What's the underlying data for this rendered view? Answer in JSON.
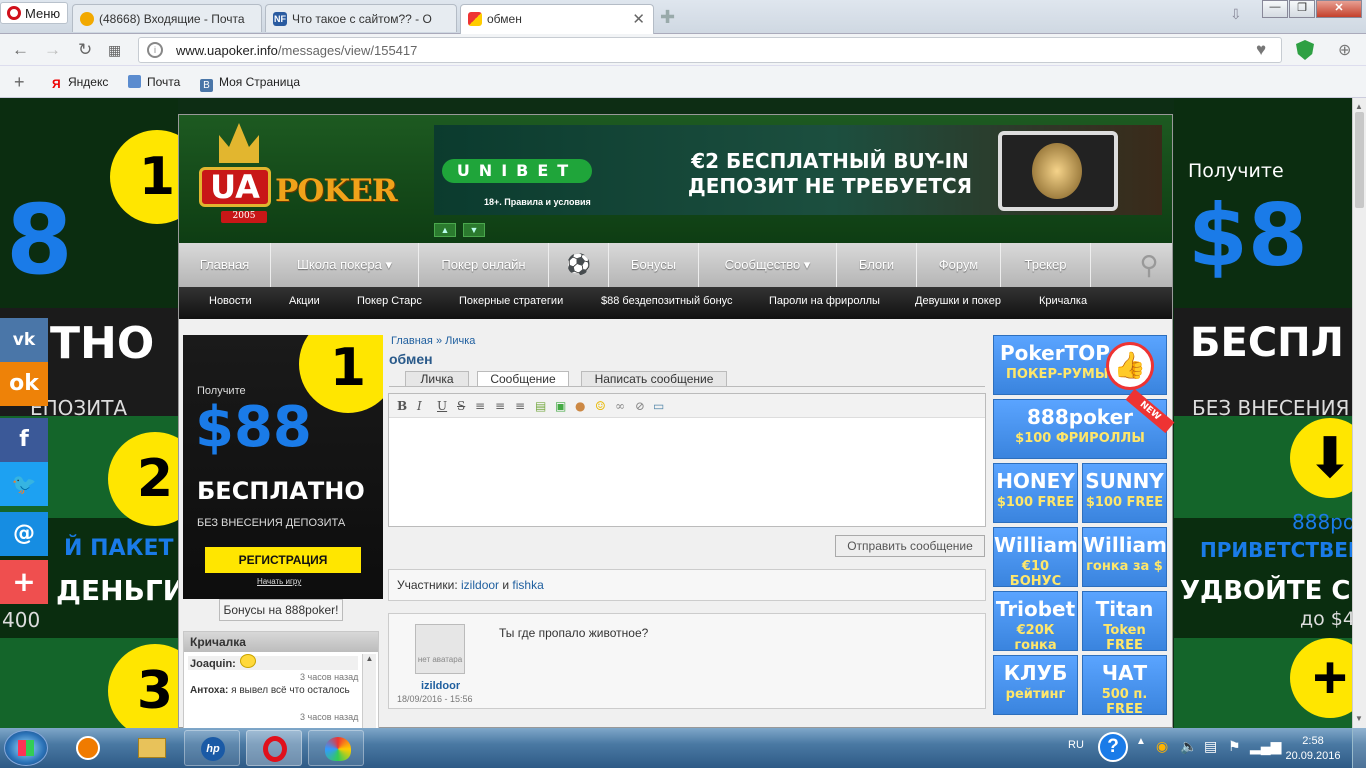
{
  "browser": {
    "menu_label": "Меню",
    "tabs": [
      {
        "title": "(48668) Входящие - Почта",
        "active": false
      },
      {
        "title": "Что такое с сайтом?? - О",
        "active": false
      },
      {
        "title": "обмен",
        "active": true
      }
    ],
    "url_domain": "www.uapoker.info",
    "url_path": "/messages/view/155417",
    "bookmarks": [
      "Яндекс",
      "Почта",
      "Моя Страница"
    ]
  },
  "left_ad": {
    "numbers": [
      "1",
      "2",
      "3"
    ],
    "big": "8",
    "line1": "ТНО",
    "line2": "ЕПОЗИТА",
    "line3": "Й ПАКЕТ",
    "line4": "ДЕНЬГИ",
    "line5": "400"
  },
  "right_ad": {
    "intro": "Получите",
    "big": "$8",
    "line1": "БЕСПЛ",
    "line2": "БЕЗ ВНЕСЕНИЯ",
    "line3": "888ро",
    "line4": "ПРИВЕТСТВЕН",
    "line5": "УДВОЙТЕ СВ",
    "line6": "до $4"
  },
  "social": [
    "vk",
    "ok",
    "f",
    "twitter",
    "@",
    "+"
  ],
  "site": {
    "logo_ua": "UA",
    "logo_poker": "POKER",
    "logo_year": "2005",
    "banner": {
      "brand": "UNIBET",
      "small": "18+. Правила и условия",
      "line1": "€2 БЕСПЛАТНЫЙ BUY-IN",
      "line2": "ДЕПОЗИТ НЕ ТРЕБУЕТСЯ"
    },
    "main_nav": [
      "Главная",
      "Школа покера ▾",
      "Покер онлайн",
      "⚽",
      "Бонусы",
      "Сообщество ▾",
      "Блоги",
      "Форум",
      "Трекер"
    ],
    "sub_nav": [
      "Новости",
      "Акции",
      "Покер Старс",
      "Покерные стратегии",
      "$88 бездепозитный бонус",
      "Пароли на фрироллы",
      "Девушки и покер",
      "Кричалка"
    ],
    "ad888": {
      "num": "1",
      "intro": "Получите",
      "amount": "$88",
      "free": "БЕСПЛАТНО",
      "nodep": "БЕЗ ВНЕСЕНИЯ ДЕПОЗИТА",
      "reg": "РЕГИСТРАЦИЯ",
      "start": "Начать игру"
    },
    "bonus_button": "Бонусы на 888poker!",
    "shoutbox": {
      "title": "Кричалка",
      "entries": [
        {
          "user": "Joaquin:",
          "text": "",
          "time": ""
        },
        {
          "user": "",
          "text": "",
          "time": "3 часов назад"
        },
        {
          "user": "Антоха:",
          "text": "я вывел всё что осталось",
          "time": ""
        },
        {
          "user": "",
          "text": "",
          "time": "3 часов назад"
        }
      ]
    },
    "breadcrumb": {
      "home": "Главная",
      "sep": "»",
      "section": "Личка"
    },
    "page_title": "обмен",
    "page_tabs": [
      "Личка",
      "Сообщение",
      "Написать сообщение"
    ],
    "send_button": "Отправить сообщение",
    "members": {
      "label": "Участники:",
      "user1": "izildoor",
      "and": "и",
      "user2": "fishka"
    },
    "message": {
      "avatar_text": "нет аватара",
      "author": "izildoor",
      "date": "18/09/2016 - 15:56",
      "text": "Ты где пропало животное?"
    },
    "right_blocks": [
      {
        "t1": "PokerTOP",
        "t2": "ПОКЕР-РУМЫ",
        "wide": true
      },
      {
        "t1": "888poker",
        "t2": "$100 ФРИРОЛЛЫ",
        "wide": true,
        "badge": "NEW"
      },
      {
        "t1": "HONEY",
        "t2": "$100 FREE"
      },
      {
        "t1": "SUNNY",
        "t2": "$100 FREE"
      },
      {
        "t1": "William",
        "t2": "€10 БОНУС"
      },
      {
        "t1": "William",
        "t2": "гонка за $"
      },
      {
        "t1": "Triobet",
        "t2": "€20К гонка"
      },
      {
        "t1": "Titan",
        "t2": "Token FREE"
      },
      {
        "t1": "КЛУБ",
        "t2": "рейтинг"
      },
      {
        "t1": "ЧАТ",
        "t2": "500 п. FREE"
      }
    ]
  },
  "taskbar": {
    "lang": "RU",
    "time": "2:58",
    "date": "20.09.2016"
  },
  "colors": {
    "accent_green": "#1fa53a",
    "link": "#1f5f9f",
    "yellow": "#ffe600",
    "blue_block": "#4a94f0"
  }
}
